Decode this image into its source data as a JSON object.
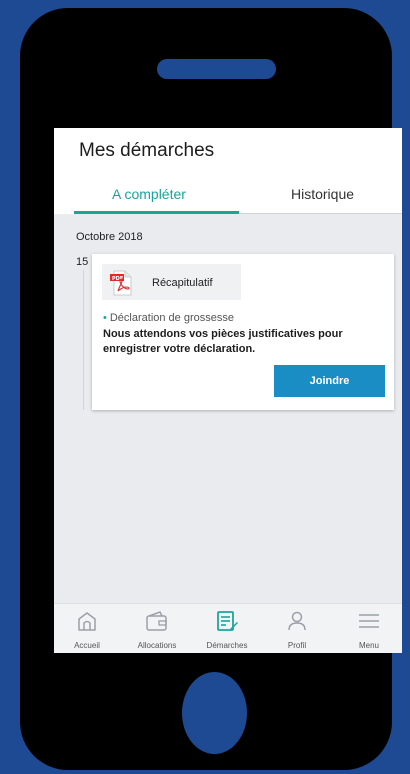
{
  "screen": {
    "title": "Mes démarches",
    "tabs": [
      {
        "label": "A compléter",
        "active": true
      },
      {
        "label": "Historique",
        "active": false
      }
    ]
  },
  "timeline": {
    "month": "Octobre 2018",
    "day": "15"
  },
  "card": {
    "file_label": "Récapitulatif",
    "file_icon": "pdf-icon",
    "subject": "Déclaration de grossesse",
    "message": "Nous attendons vos pièces justificatives pour enregistrer votre déclaration.",
    "button": "Joindre"
  },
  "nav": [
    {
      "label": "Accueil",
      "icon": "home-icon",
      "active": false
    },
    {
      "label": "Allocations",
      "icon": "wallet-icon",
      "active": false
    },
    {
      "label": "Démarches",
      "icon": "edit-document-icon",
      "active": true
    },
    {
      "label": "Profil",
      "icon": "user-icon",
      "active": false
    },
    {
      "label": "Menu",
      "icon": "hamburger-menu-icon",
      "active": false
    }
  ],
  "colors": {
    "background": "#1d4a93",
    "accent": "#1aa59b",
    "button": "#1a8dc4"
  }
}
